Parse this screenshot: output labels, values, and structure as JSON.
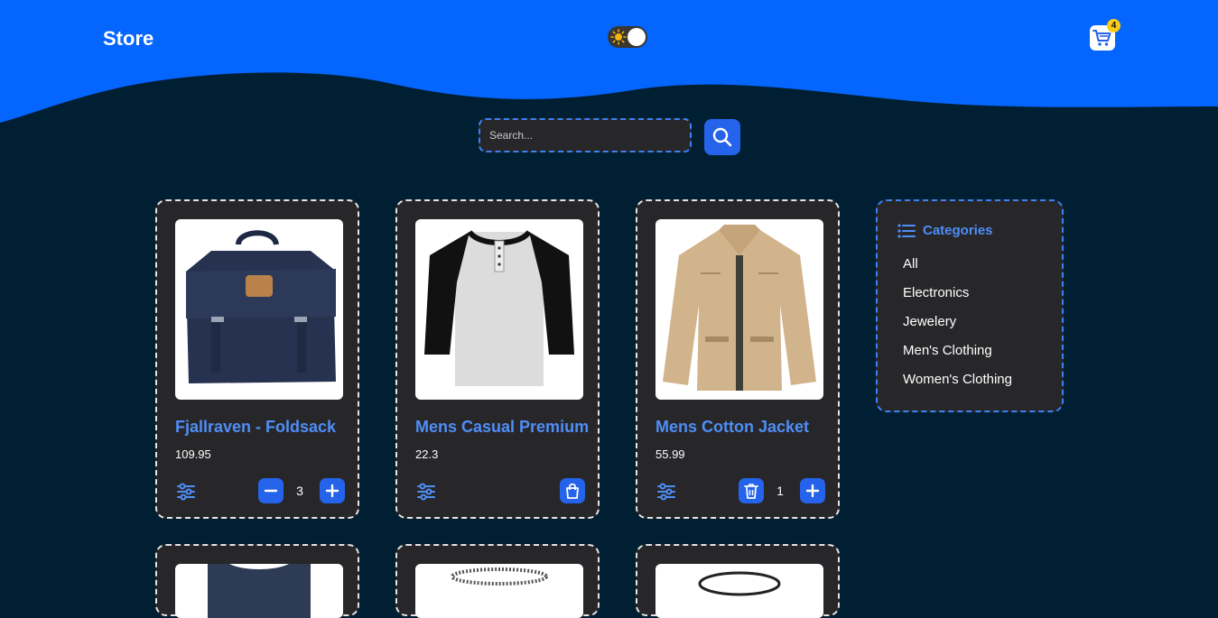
{
  "header": {
    "brand": "Store",
    "theme_toggle_icon": "sun-icon",
    "cart_icon": "cart-icon",
    "cart_count": "4",
    "colors": {
      "header_bg": "#0565ff",
      "page_bg": "#001f33",
      "accent": "#2563eb",
      "badge": "#facc15"
    }
  },
  "search": {
    "placeholder": "Search...",
    "value": "",
    "button_icon": "search-icon"
  },
  "products": [
    {
      "title": "Fjallraven - Foldsack",
      "price": "109.95",
      "image": "backpack",
      "in_cart": true,
      "quantity": "3"
    },
    {
      "title": "Mens Casual Premium",
      "price": "22.3",
      "image": "raglan-tshirt",
      "in_cart": false
    },
    {
      "title": "Mens Cotton Jacket",
      "price": "55.99",
      "image": "jacket",
      "in_cart": true,
      "quantity": "1"
    }
  ],
  "categories": {
    "heading": "Categories",
    "heading_icon": "list-icon",
    "items": [
      "All",
      "Electronics",
      "Jewelery",
      "Men's Clothing",
      "Women's Clothing"
    ]
  }
}
